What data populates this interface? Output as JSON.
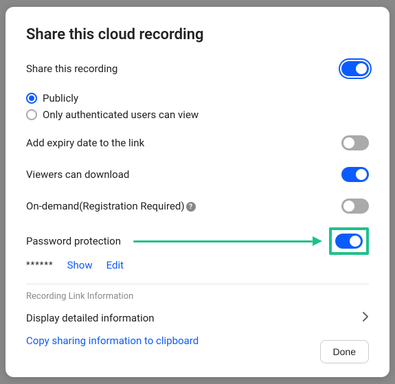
{
  "title": "Share this cloud recording",
  "settings": {
    "share": {
      "label": "Share this recording",
      "on": true
    },
    "visibility": {
      "publicly": "Publicly",
      "authenticated": "Only authenticated users can view",
      "selected": "publicly"
    },
    "expiry": {
      "label": "Add expiry date to the link",
      "on": false
    },
    "download": {
      "label": "Viewers can download",
      "on": true
    },
    "ondemand": {
      "label": "On-demand(Registration Required)",
      "on": false
    },
    "password": {
      "label": "Password protection",
      "on": true,
      "mask": "******",
      "show": "Show",
      "edit": "Edit"
    }
  },
  "linkInfo": {
    "section": "Recording Link Information",
    "display": "Display detailed information",
    "copy": "Copy sharing information to clipboard"
  },
  "footer": {
    "done": "Done"
  },
  "annotation": {
    "color": "#1ec28b"
  }
}
